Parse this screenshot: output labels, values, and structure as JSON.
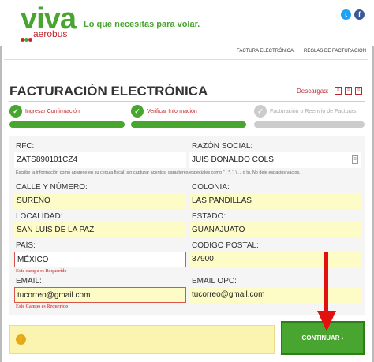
{
  "brand": {
    "logo_main": "viva",
    "logo_sub": "aerobus",
    "tagline": "Lo que necesitas para volar.",
    "color_green": "#48a52f",
    "color_red": "#c0272d"
  },
  "social": [
    {
      "icon": "twitter-icon",
      "glyph": "t"
    },
    {
      "icon": "facebook-icon",
      "glyph": "f"
    }
  ],
  "topnav": {
    "items": [
      "FACTURA ELECTRÓNICA",
      "REGLAS DE FACTURACIÓN"
    ]
  },
  "page": {
    "title": "FACTURACIÓN ELECTRÓNICA",
    "downloads_label": "Descargas:"
  },
  "steps": [
    {
      "label": "Ingresar Confirmación",
      "status": "done",
      "icon": "check-icon"
    },
    {
      "label": "Verificar Información",
      "status": "done",
      "icon": "check-icon"
    },
    {
      "label": "Facturación o Reenvío de Facturas",
      "status": "pending",
      "icon": "check-icon"
    }
  ],
  "form": {
    "rfc": {
      "label": "RFC:",
      "value": "ZATS890101CZ4"
    },
    "razon_social": {
      "label": "RAZÓN SOCIAL:",
      "value": "JUIS DONALDO COLS"
    },
    "hint": "Escribe la información como aparece en su cedula fiscal, sin capturar acentos, caracteres especiales como \" , *, ', \\ , / o tu. No deje espacios vacios.",
    "calle": {
      "label": "CALLE Y NÚMERO:",
      "value": "SUREÑO"
    },
    "colonia": {
      "label": "COLONIA:",
      "value": "LAS PANDILLAS"
    },
    "localidad": {
      "label": "LOCALIDAD:",
      "value": "SAN LUIS DE LA PAZ"
    },
    "estado": {
      "label": "ESTADO:",
      "value": "GUANAJUATO"
    },
    "pais": {
      "label": "PAÍS:",
      "value": "MÉXICO",
      "error": "Este campo es Requerido"
    },
    "codigo_postal": {
      "label": "CODIGO POSTAL:",
      "value": "37900"
    },
    "email": {
      "label": "EMAIL:",
      "value": "tucorreo@gmail.com",
      "error": "Este Campo es Requerido"
    },
    "email_opc": {
      "label": "EMAIL OPC:",
      "value": "tucorreo@gmail.com"
    }
  },
  "actions": {
    "continue_label": "CONTINUAR ›"
  }
}
